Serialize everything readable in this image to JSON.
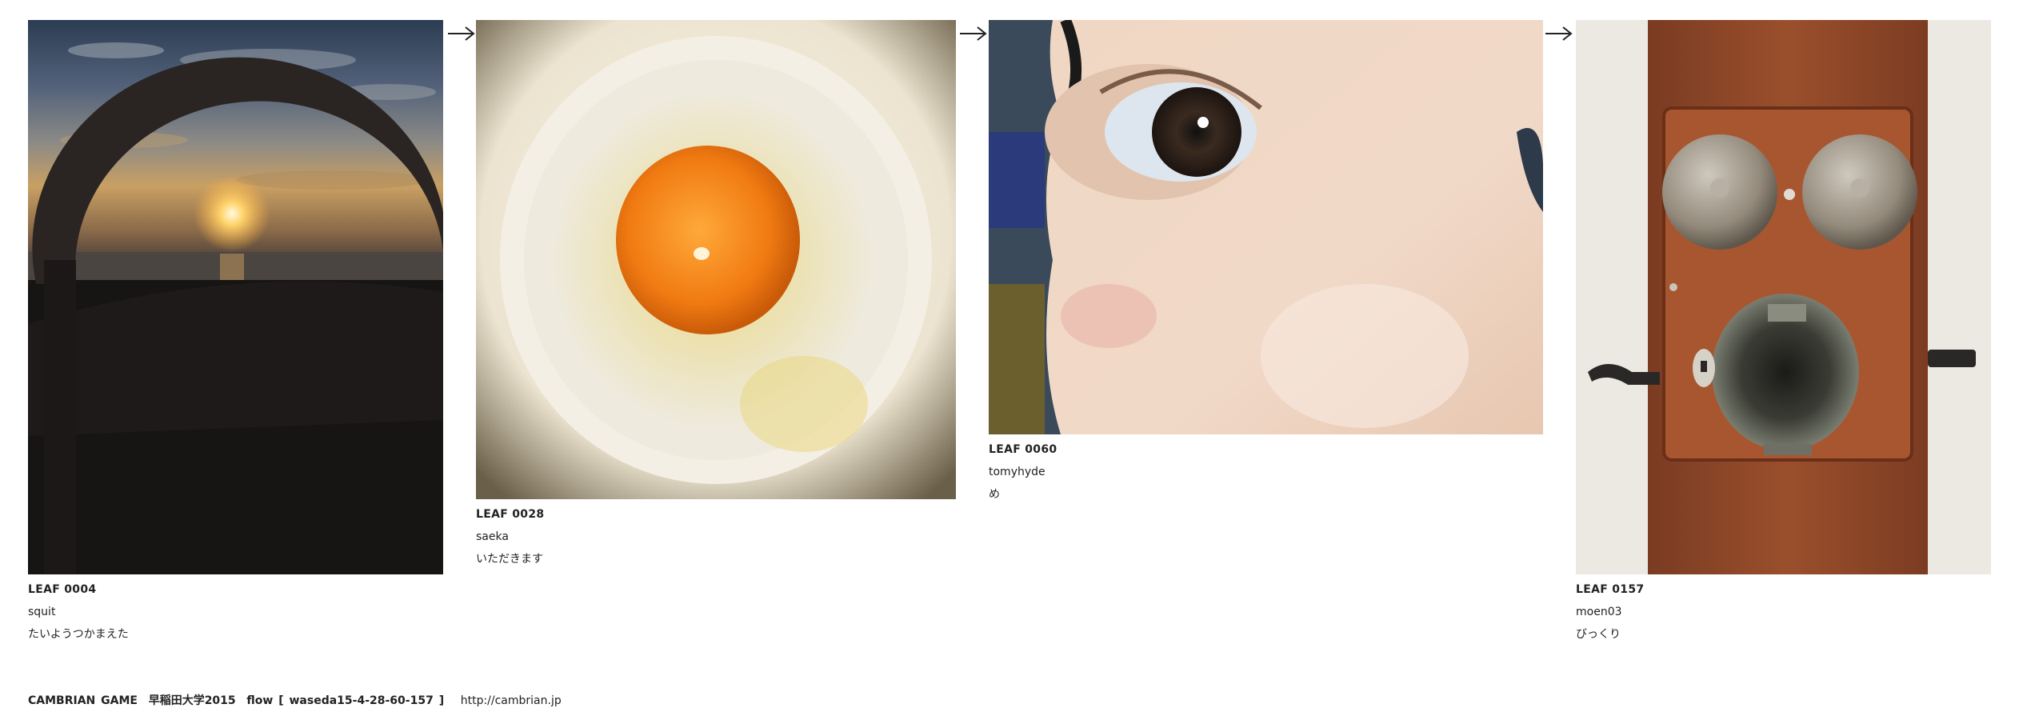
{
  "leaves": [
    {
      "leaf": "LEAF 0004",
      "user": "squit",
      "title": "たいようつかまえた",
      "image": "sunset-arch-photo"
    },
    {
      "leaf": "LEAF 0028",
      "user": "saeka",
      "title": "いただきます",
      "image": "egg-on-rice-photo"
    },
    {
      "leaf": "LEAF 0060",
      "user": "tomyhyde",
      "title": "め",
      "image": "eye-closeup-photo"
    },
    {
      "leaf": "LEAF 0157",
      "user": "moen03",
      "title": "びっくり",
      "image": "antique-wall-telephone-photo"
    }
  ],
  "arrows": [
    "arrow-right-icon",
    "arrow-right-icon",
    "arrow-right-icon"
  ],
  "footer": {
    "text": "CAMBRIAN GAME  早稲田大学2015  flow [ waseda15-4-28-60-157 ]",
    "url": "http://cambrian.jp"
  }
}
